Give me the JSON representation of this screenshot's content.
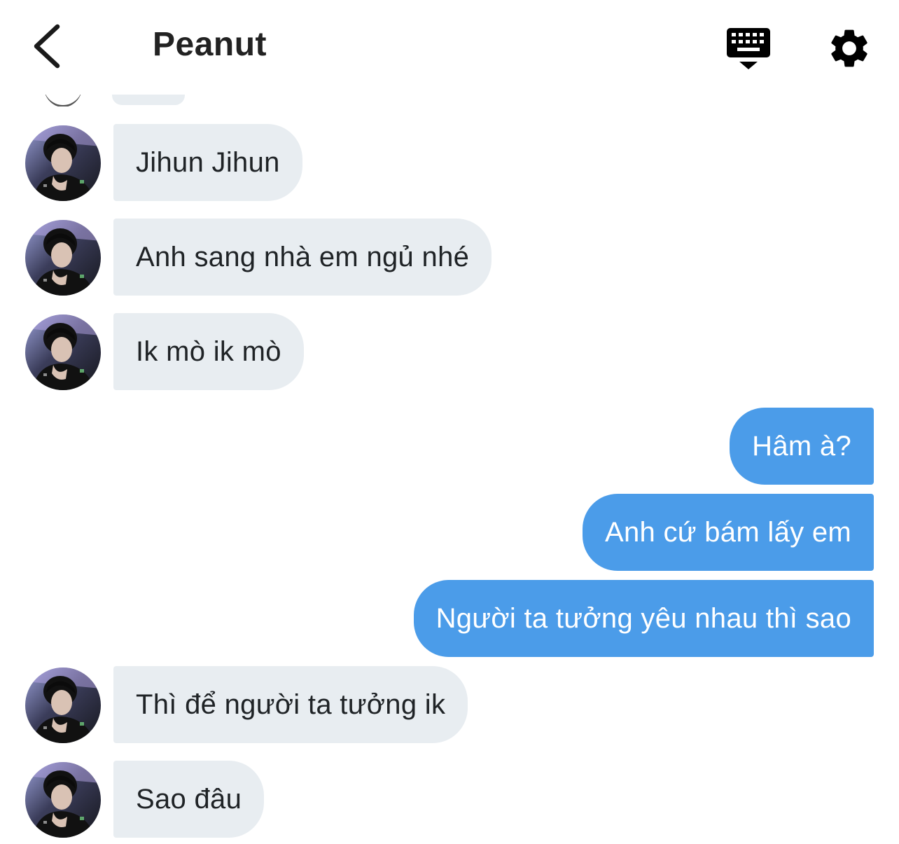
{
  "header": {
    "title": "Peanut",
    "back_icon": "chevron-left-icon",
    "keyboard_icon": "keyboard-icon",
    "settings_icon": "gear-icon"
  },
  "colors": {
    "incoming_bubble": "#e8edf1",
    "outgoing_bubble": "#4b9ce9"
  },
  "messages": [
    {
      "direction": "in",
      "text": "Jihun Jihun"
    },
    {
      "direction": "in",
      "text": "Anh sang nhà em ngủ nhé"
    },
    {
      "direction": "in",
      "text": "Ik mò ik mò"
    },
    {
      "direction": "out",
      "text": "Hâm à?"
    },
    {
      "direction": "out",
      "text": "Anh cứ bám lấy em"
    },
    {
      "direction": "out",
      "text": "Người ta tưởng yêu nhau thì sao"
    },
    {
      "direction": "in",
      "text": "Thì để người ta tưởng ik"
    },
    {
      "direction": "in",
      "text": "Sao đâu"
    }
  ]
}
